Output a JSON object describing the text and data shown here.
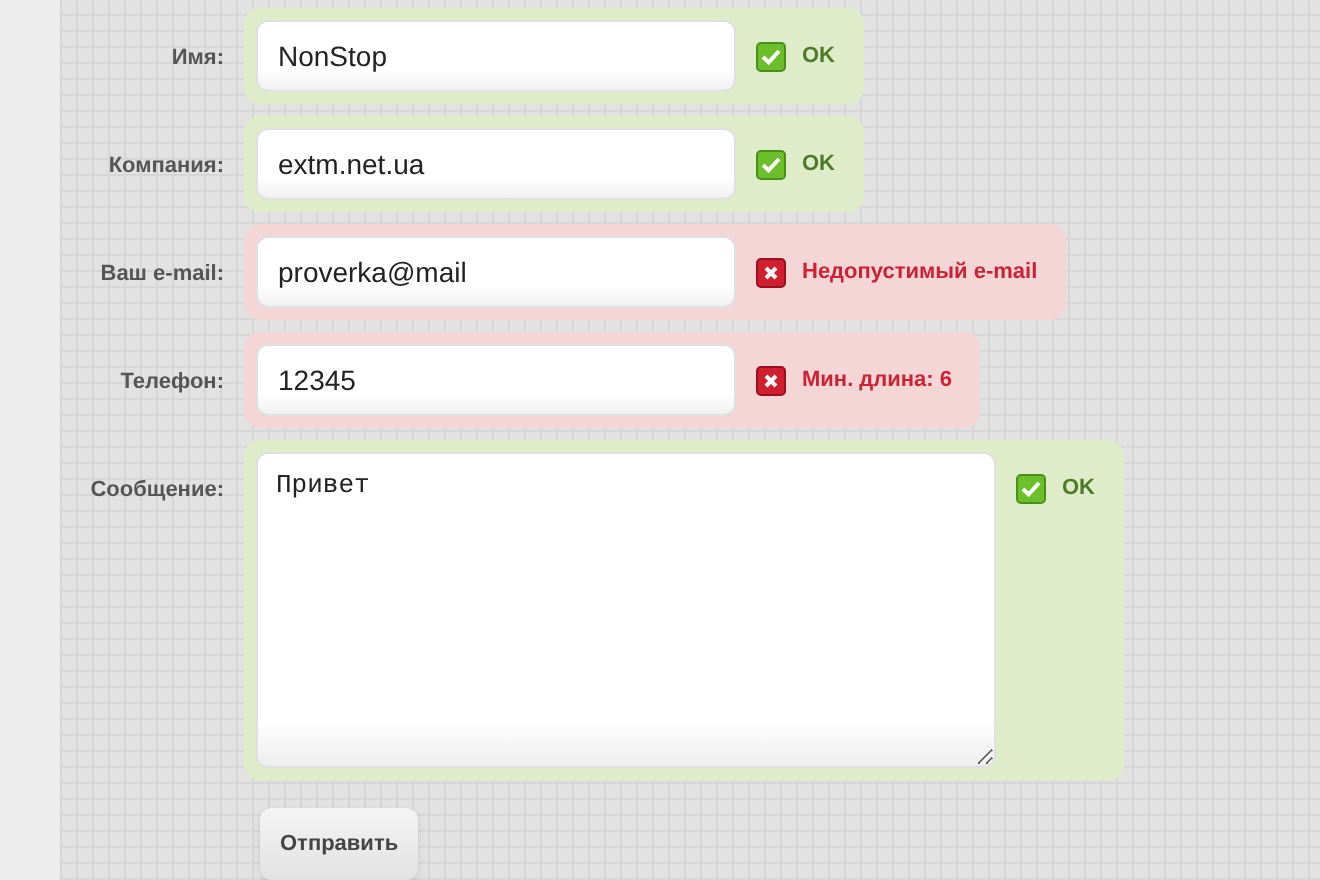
{
  "fields": [
    {
      "kind": "input",
      "label": "Имя:",
      "value": "NonStop",
      "valid": true,
      "message": "OK"
    },
    {
      "kind": "input",
      "label": "Компания:",
      "value": "extm.net.ua",
      "valid": true,
      "message": "OK"
    },
    {
      "kind": "input",
      "label": "Ваш e-mail:",
      "value": "proverka@mail",
      "valid": false,
      "message": "Недопустимый e-mail"
    },
    {
      "kind": "input",
      "label": "Телефон:",
      "value": "12345",
      "valid": false,
      "message": "Мин. длина: 6"
    },
    {
      "kind": "textarea",
      "label": "Сообщение:",
      "value": "Привет",
      "valid": true,
      "message": "OK"
    }
  ],
  "submit_button": "Отправить"
}
